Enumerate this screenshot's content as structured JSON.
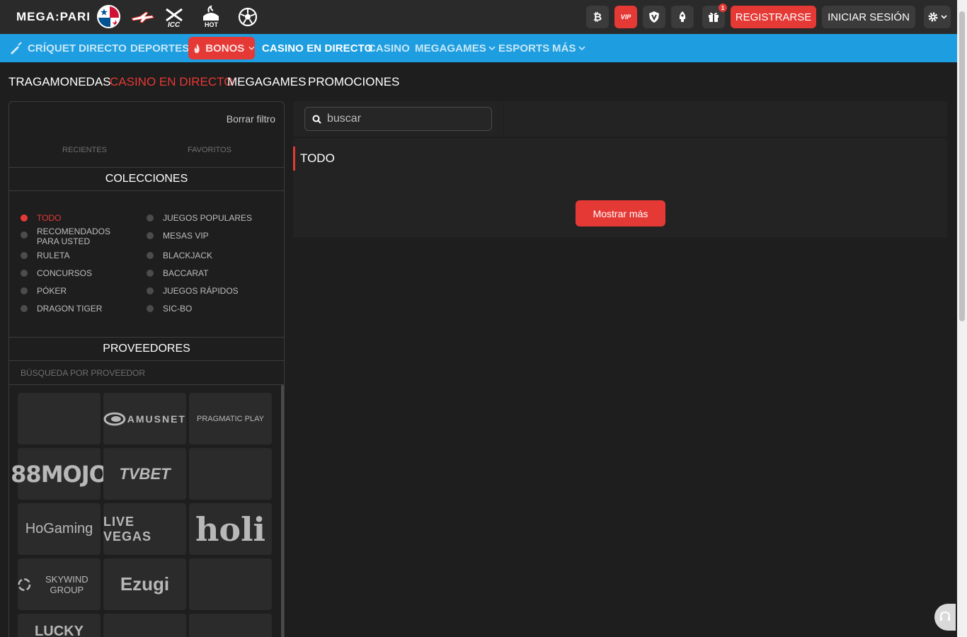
{
  "header": {
    "logo_text": "MEGA",
    "logo_text2": "PARI",
    "vip_label": "VIP",
    "gift_badge": "1",
    "register_label": "REGISTRARSE",
    "login_label": "INICIAR SESIÓN",
    "hot_label": "HOT",
    "icc_label": "ICC"
  },
  "nav": {
    "items": [
      "CRÍQUET",
      "DIRECTO",
      "DEPORTES",
      "BONOS",
      "CASINO EN DIRECTO",
      "CASINO",
      "MEGAGAMES",
      "ESPORTS",
      "MÁS"
    ],
    "active": "CASINO EN DIRECTO"
  },
  "subtabs": [
    "TRAGAMONEDAS",
    "CASINO EN DIRECTO",
    "MEGAGAMES",
    "PROMOCIONES"
  ],
  "sidebar": {
    "clear_filter": "Borrar filtro",
    "tabs": [
      "RECIENTES",
      "FAVORITOS"
    ],
    "collections_title": "COLECCIONES",
    "collections_left": [
      "TODO",
      "RECOMENDADOS PARA USTED",
      "RULETA",
      "CONCURSOS",
      "PÓKER",
      "DRAGON TIGER"
    ],
    "collections_right": [
      "JUEGOS POPULARES",
      "MESAS VIP",
      "BLACKJACK",
      "BACCARAT",
      "JUEGOS RÁPIDOS",
      "SIC-BO"
    ],
    "providers_title": "PROVEEDORES",
    "provider_search_placeholder": "BÚSQUEDA POR PROVEEDOR",
    "providers": [
      "",
      "AMUSNET",
      "PRAGMATIC PLAY",
      "88MOJO",
      "TVBET",
      "",
      "HoGaming",
      "LIVE VEGAS",
      "holi",
      "SKYWIND GROUP",
      "Ezugi",
      "",
      "LUCKY",
      "",
      ""
    ]
  },
  "main": {
    "search_placeholder": "buscar",
    "section_title": "TODO",
    "show_more_label": "Mostrar más"
  },
  "colors": {
    "accent": "#e53935",
    "nav_blue": "#1e9ee0",
    "background": "#1e1e1e"
  }
}
